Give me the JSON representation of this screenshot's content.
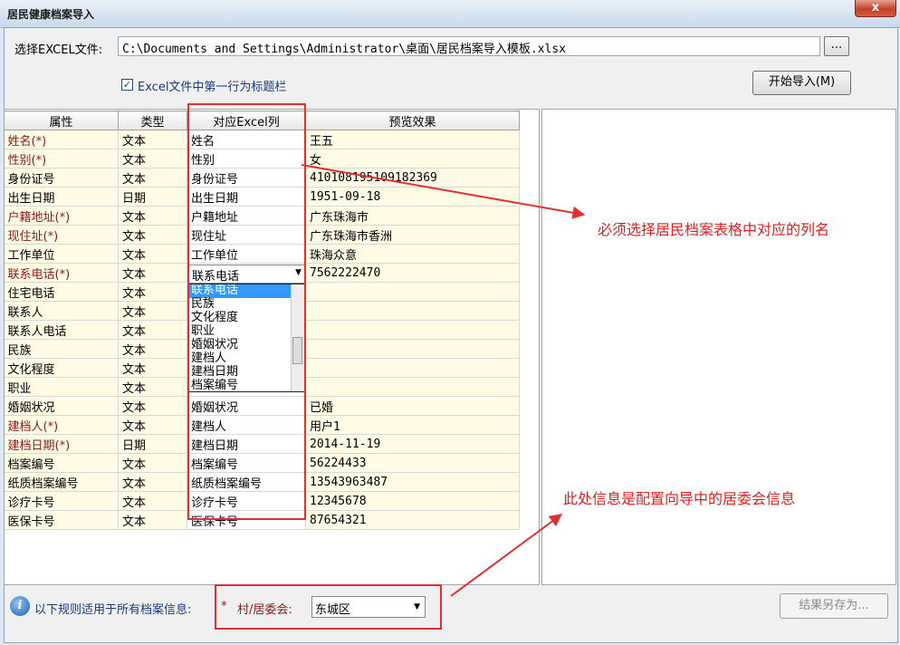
{
  "window": {
    "title": "居民健康档案导入",
    "close_glyph": "x"
  },
  "file": {
    "label": "选择EXCEL文件:",
    "path": "C:\\Documents and Settings\\Administrator\\桌面\\居民档案导入模板.xlsx",
    "browse_label": "..."
  },
  "options": {
    "first_row_header_label": "Excel文件中第一行为标题栏",
    "first_row_header_checked": true
  },
  "import_button": "开始导入(M)",
  "grid": {
    "headers": [
      "属性",
      "类型",
      "对应Excel列",
      "预览效果"
    ],
    "rows": [
      {
        "attr": "姓名(*)",
        "type": "文本",
        "col": "姓名",
        "preview": "王五",
        "required": true
      },
      {
        "attr": "性别(*)",
        "type": "文本",
        "col": "性别",
        "preview": "女",
        "required": true
      },
      {
        "attr": "身份证号",
        "type": "文本",
        "col": "身份证号",
        "preview": "410108195109182369",
        "required": false
      },
      {
        "attr": "出生日期",
        "type": "日期",
        "col": "出生日期",
        "preview": "1951-09-18",
        "required": false
      },
      {
        "attr": "户籍地址(*)",
        "type": "文本",
        "col": "户籍地址",
        "preview": "广东珠海市",
        "required": true
      },
      {
        "attr": "现住址(*)",
        "type": "文本",
        "col": "现住址",
        "preview": "广东珠海市香洲",
        "required": true
      },
      {
        "attr": "工作单位",
        "type": "文本",
        "col": "工作单位",
        "preview": "珠海众意",
        "required": false
      },
      {
        "attr": "联系电话(*)",
        "type": "文本",
        "col": "",
        "preview": "7562222470",
        "required": true
      },
      {
        "attr": "住宅电话",
        "type": "文本",
        "col": "",
        "preview": "",
        "required": false
      },
      {
        "attr": "联系人",
        "type": "文本",
        "col": "",
        "preview": "",
        "required": false
      },
      {
        "attr": "联系人电话",
        "type": "文本",
        "col": "",
        "preview": "",
        "required": false
      },
      {
        "attr": "民族",
        "type": "文本",
        "col": "",
        "preview": "",
        "required": false
      },
      {
        "attr": "文化程度",
        "type": "文本",
        "col": "",
        "preview": "",
        "required": false
      },
      {
        "attr": "职业",
        "type": "文本",
        "col": "",
        "preview": "",
        "required": false
      },
      {
        "attr": "婚姻状况",
        "type": "文本",
        "col": "婚姻状况",
        "preview": "已婚",
        "required": false
      },
      {
        "attr": "建档人(*)",
        "type": "文本",
        "col": "建档人",
        "preview": "用户1",
        "required": true
      },
      {
        "attr": "建档日期(*)",
        "type": "日期",
        "col": "建档日期",
        "preview": "2014-11-19",
        "required": true
      },
      {
        "attr": "档案编号",
        "type": "文本",
        "col": "档案编号",
        "preview": "56224433",
        "required": false
      },
      {
        "attr": "纸质档案编号",
        "type": "文本",
        "col": "纸质档案编号",
        "preview": "13543963487",
        "required": false
      },
      {
        "attr": "诊疗卡号",
        "type": "文本",
        "col": "诊疗卡号",
        "preview": "12345678",
        "required": false
      },
      {
        "attr": "医保卡号",
        "type": "文本",
        "col": "医保卡号",
        "preview": "87654321",
        "required": false
      }
    ]
  },
  "combo": {
    "value": "联系电话",
    "arrow_glyph": "▼"
  },
  "dropdown": {
    "items": [
      "联系电话",
      "民族",
      "文化程度",
      "职业",
      "婚姻状况",
      "建档人",
      "建档日期",
      "档案编号"
    ],
    "selected_index": 0
  },
  "bottom": {
    "rule_text": "以下规则适用于所有档案信息:",
    "required_mark": "*",
    "village_label": "村/居委会:",
    "village_value": "东城区",
    "village_arrow": "▼",
    "save_as": "结果另存为..."
  },
  "info_glyph": "i",
  "annotations": {
    "column_note": "必须选择居民档案表格中对应的列名",
    "village_note": "此处信息是配置向导中的居委会信息"
  },
  "colors": {
    "annotation_red": "#e03030",
    "required_text": "#8b1a1a",
    "selection_blue": "#3399ff"
  }
}
